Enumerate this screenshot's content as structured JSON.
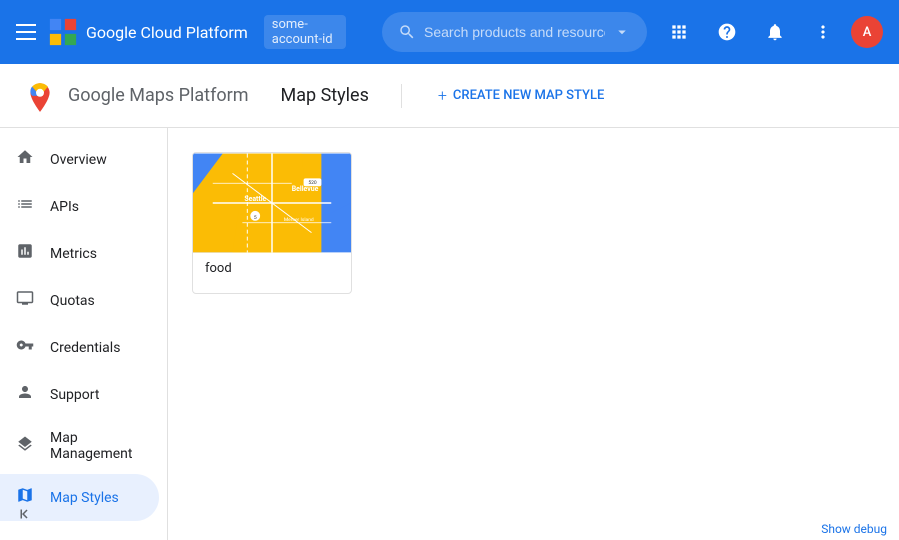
{
  "topbar": {
    "title": "Google Cloud Platform",
    "account": "some-account-id",
    "search_placeholder": "Search products and resources",
    "menu_icon": "menu-icon",
    "apps_icon": "apps-icon",
    "help_icon": "help-icon",
    "bell_icon": "bell-icon",
    "more_icon": "more-vert-icon"
  },
  "subheader": {
    "product": "Google Maps Platform",
    "page": "Map Styles",
    "create_label": "CREATE NEW MAP STYLE"
  },
  "sidebar": {
    "items": [
      {
        "id": "overview",
        "label": "Overview",
        "icon": "home"
      },
      {
        "id": "apis",
        "label": "APIs",
        "icon": "list"
      },
      {
        "id": "metrics",
        "label": "Metrics",
        "icon": "bar-chart"
      },
      {
        "id": "quotas",
        "label": "Quotas",
        "icon": "monitor"
      },
      {
        "id": "credentials",
        "label": "Credentials",
        "icon": "vpn-key"
      },
      {
        "id": "support",
        "label": "Support",
        "icon": "person"
      },
      {
        "id": "map-management",
        "label": "Map Management",
        "icon": "layers"
      },
      {
        "id": "map-styles",
        "label": "Map Styles",
        "icon": "map",
        "active": true
      }
    ],
    "collapse_icon": "chevron-left-icon"
  },
  "main": {
    "map_style": {
      "label": "food",
      "thumbnail_alt": "Seattle map style preview"
    }
  },
  "bottom": {
    "debug_label": "Show debug"
  }
}
